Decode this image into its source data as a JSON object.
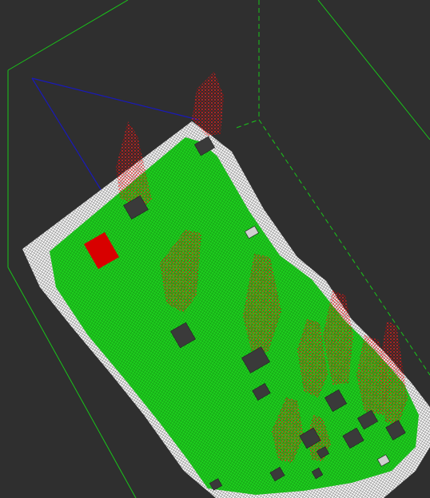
{
  "viewer": {
    "background_color": "#2f2f2f",
    "colors": {
      "terrain_points": "#1ecf1e",
      "terrain_mesh": "#0d6d0d",
      "boundary_points": "#ffffff",
      "tree_points": "#ff1010",
      "tree_dark": "#9a0000",
      "bounding_box": "#19c419",
      "selection_line": "#1a1ab8",
      "object_markers": "#3a3a3a"
    },
    "scene": {
      "bounding_box": true,
      "terrain_grid": true,
      "tree_point_clouds": 10,
      "ground_markers": 16
    }
  }
}
